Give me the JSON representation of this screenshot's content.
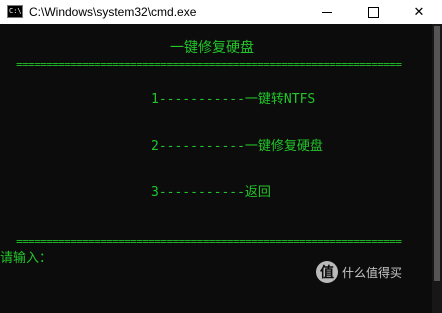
{
  "window": {
    "title": "C:\\Windows\\system32\\cmd.exe",
    "icon": "console-icon",
    "icon_glyph": "C:\\",
    "controls": {
      "minimize": "minimize-icon",
      "maximize": "maximize-icon",
      "close": "close-icon",
      "close_glyph": "✕"
    }
  },
  "console": {
    "fg_color": "#22c52a",
    "bg_color": "#0c0c0c",
    "heading": "一键修复硬盘",
    "separator": "================================================================",
    "options": [
      {
        "label": "1-----------一键转NTFS"
      },
      {
        "label": "2-----------一键修复硬盘"
      },
      {
        "label": "3-----------返回"
      }
    ],
    "prompt": "请输入："
  },
  "watermark": {
    "logo_text": "值",
    "text": "什么值得买"
  }
}
